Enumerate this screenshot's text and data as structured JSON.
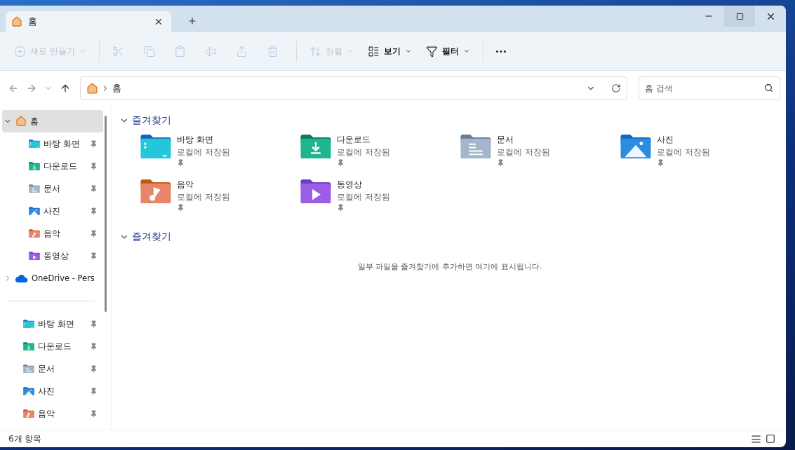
{
  "tabs": [
    {
      "label": "홈",
      "selected": true
    }
  ],
  "toolbar": [
    {
      "kind": "new",
      "label": "새로 만들기",
      "disabled": true,
      "dropdown": true
    },
    {
      "kind": "cut",
      "disabled": true
    },
    {
      "kind": "copy",
      "disabled": true
    },
    {
      "kind": "paste",
      "disabled": true
    },
    {
      "kind": "rename",
      "disabled": true
    },
    {
      "kind": "share",
      "disabled": true
    },
    {
      "kind": "delete",
      "disabled": true
    },
    {
      "kind": "sort",
      "label": "정렬",
      "disabled": true,
      "dropdown": true
    },
    {
      "kind": "view",
      "label": "보기",
      "disabled": false,
      "dropdown": true
    },
    {
      "kind": "filter",
      "label": "필터",
      "disabled": false,
      "dropdown": true
    },
    {
      "kind": "more",
      "disabled": false
    }
  ],
  "address": {
    "crumbs": [
      "홈"
    ]
  },
  "search": {
    "placeholder": "홈 검색"
  },
  "sidebar": {
    "tree": [
      {
        "label": "홈",
        "kind": "home",
        "selected": true,
        "expanded": true,
        "children": [
          {
            "label": "바탕 화면",
            "kind": "desktop",
            "selected": false
          },
          {
            "label": "다운로드",
            "kind": "download",
            "selected": false
          },
          {
            "label": "문서",
            "kind": "documents",
            "selected": false
          },
          {
            "label": "사진",
            "kind": "pictures",
            "selected": false
          },
          {
            "label": "음악",
            "kind": "music",
            "selected": false
          },
          {
            "label": "동영상",
            "kind": "videos",
            "selected": false
          }
        ]
      },
      {
        "label": "OneDrive - Pers",
        "kind": "cloud",
        "selected": false,
        "expanded": false
      }
    ],
    "quick_access": [
      {
        "label": "바탕 화면",
        "kind": "desktop",
        "selected": false
      },
      {
        "label": "다운로드",
        "kind": "download",
        "selected": false
      },
      {
        "label": "문서",
        "kind": "documents",
        "selected": false
      },
      {
        "label": "사진",
        "kind": "pictures",
        "selected": false
      },
      {
        "label": "음악",
        "kind": "music",
        "selected": false
      }
    ]
  },
  "sections": [
    {
      "title": "즐겨찾기",
      "expanded": true,
      "items": [
        {
          "name": "바탕 화면",
          "status": "로컬에 저장됨",
          "kind": "desktop"
        },
        {
          "name": "다운로드",
          "status": "로컬에 저장됨",
          "kind": "download"
        },
        {
          "name": "문서",
          "status": "로컬에 저장됨",
          "kind": "documents"
        },
        {
          "name": "사진",
          "status": "로컬에 저장됨",
          "kind": "pictures"
        },
        {
          "name": "음악",
          "status": "로컬에 저장됨",
          "kind": "music"
        },
        {
          "name": "동영상",
          "status": "로컬에 저장됨",
          "kind": "videos"
        }
      ]
    },
    {
      "title": "즐겨찾기",
      "expanded": true,
      "empty_message": "일부 파일을 즐겨찾기에 추가하면 여기에 표시됩니다."
    }
  ],
  "status_bar": {
    "count": "6개 항목"
  }
}
